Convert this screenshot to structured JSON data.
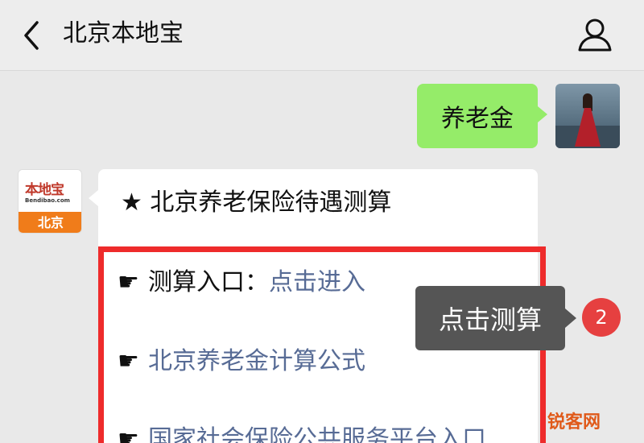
{
  "header": {
    "title": "北京本地宝",
    "back_icon": "chevron-left-icon",
    "user_icon": "user-icon"
  },
  "messages": {
    "sent": {
      "text": "养老金"
    },
    "received": {
      "account_logo": "本地宝",
      "account_sub": "Bendibao.com",
      "account_city": "北京",
      "title": "★ 北京养老保险待遇测算",
      "rows": [
        {
          "hand": "☛",
          "label": "测算入口：",
          "link": "点击进入"
        },
        {
          "hand": "☛",
          "label": "",
          "link": "北京养老金计算公式"
        },
        {
          "hand": "☛",
          "label": "",
          "link": "国家社会保险公共服务平台入口"
        }
      ]
    }
  },
  "tooltip": {
    "text": "点击测算"
  },
  "step_badge": {
    "text": "2"
  },
  "watermark": {
    "text": "锐客网"
  },
  "colors": {
    "sent_bubble": "#95ec69",
    "link": "#576b95",
    "highlight": "#ee2b2b",
    "badge": "#e64040",
    "tooltip_bg": "#555555"
  }
}
